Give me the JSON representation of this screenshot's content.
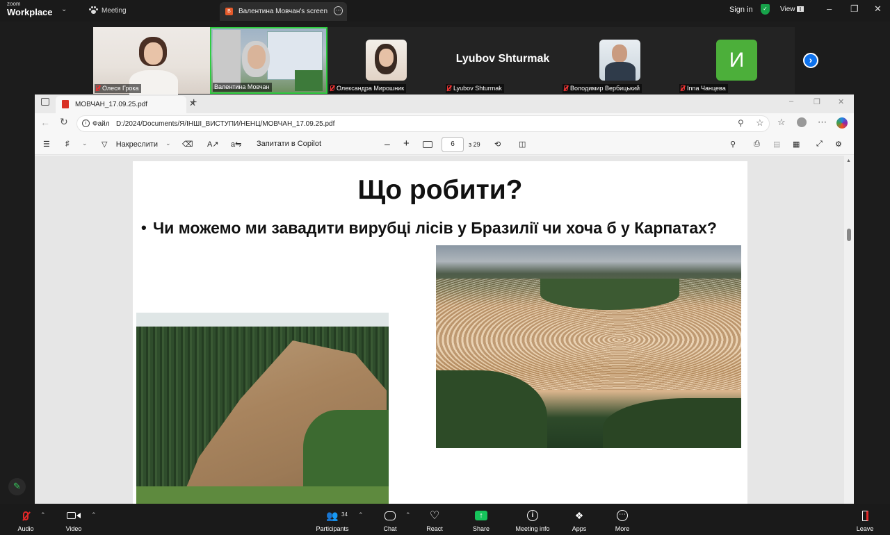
{
  "app": {
    "logo_top": "zoom",
    "logo_bottom": "Workplace",
    "meeting_tab": "Meeting",
    "screen_tab": "Валентина Мовчан's screen",
    "screen_badge": "В",
    "sign_in": "Sign in",
    "view": "View"
  },
  "participants": [
    {
      "name": "Олеся Грока",
      "muted": true
    },
    {
      "name": "Валентина Мовчан",
      "muted": false,
      "active_speaker": true
    },
    {
      "name": "Олександра Мирошник",
      "muted": true
    },
    {
      "name": "Lyubov Shturmak",
      "muted": true
    },
    {
      "name": "Володимир Вербицький",
      "muted": true
    },
    {
      "name": "Inna Чанцева",
      "muted": true,
      "avatar_letter": "И",
      "avatar_color": "#4caf3a"
    }
  ],
  "big_name": "Lyubov Shturmak",
  "browser": {
    "tab_title": "МОВЧАН_17.09.25.pdf",
    "file_label": "Файл",
    "url": "D:/2024/Documents/Я/ІНШІ_ВИСТУПИ/НЕНЦ/МОВЧАН_17.09.25.pdf",
    "draw_label": "Накреслити",
    "copilot_label": "Запитати в Copilot",
    "page_current": "6",
    "page_total": "з 29"
  },
  "slide": {
    "title": "Що робити?",
    "bullet": "Чи можемо ми завадити вирубці лісів у Бразилії чи хоча б у Карпатах?"
  },
  "toolbar": {
    "audio": "Audio",
    "video": "Video",
    "participants": "Participants",
    "participants_count": "34",
    "chat": "Chat",
    "react": "React",
    "share": "Share",
    "meeting_info": "Meeting info",
    "apps": "Apps",
    "more": "More",
    "leave": "Leave"
  },
  "colors": {
    "zoom_blue": "#0e72ed",
    "share_green": "#16c45b",
    "leave_red": "#e02828",
    "active_speaker": "#2ecc40"
  }
}
